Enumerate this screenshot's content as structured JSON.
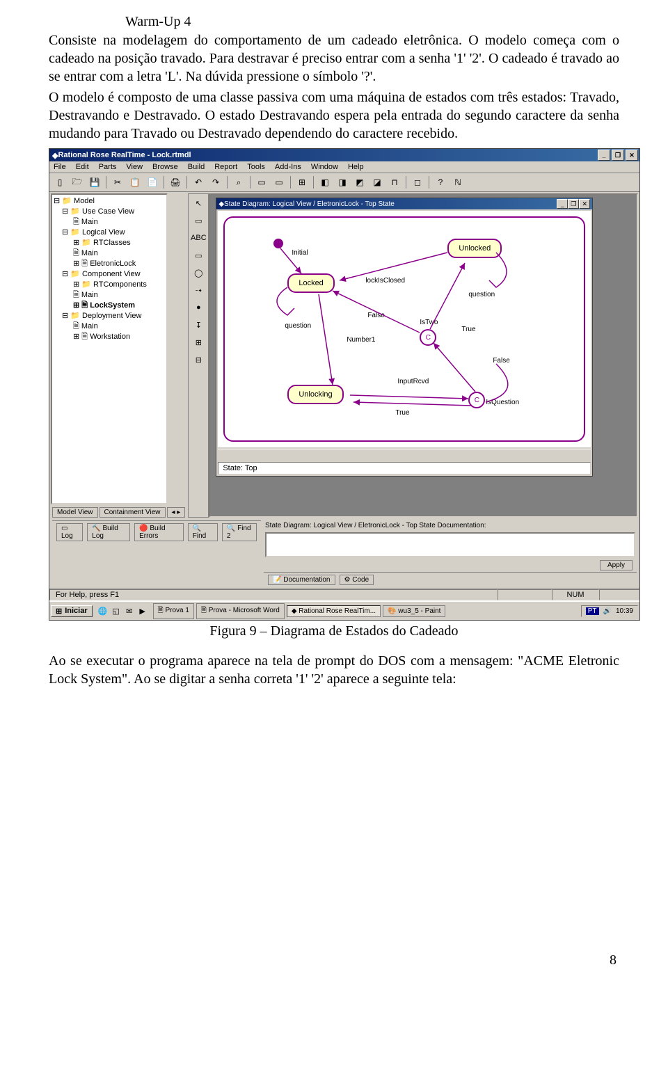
{
  "doc": {
    "title": "Warm-Up 4",
    "p1": "Consiste na modelagem do comportamento de um cadeado eletrônica. O modelo começa com o cadeado na posição travado. Para destravar é preciso entrar com a senha '1' '2'. O cadeado é travado ao se entrar com a letra 'L'. Na dúvida pressione o símbolo '?'.",
    "p2": "O modelo é composto de uma classe passiva com uma máquina de estados com três estados: Travado, Destravando e Destravado. O estado Destravando espera pela entrada do segundo caractere da senha mudando para Travado ou Destravado dependendo do caractere recebido.",
    "fig_caption": "Figura 9 – Diagrama de Estados do Cadeado",
    "p3": "Ao se executar o programa aparece na tela de prompt do DOS com a mensagem: \"ACME Eletronic Lock System\". Ao se digitar a senha correta '1' '2' aparece a seguinte tela:",
    "page_number": "8"
  },
  "app": {
    "window_title": "Rational Rose RealTime - Lock.rtmdl",
    "menus": [
      "File",
      "Edit",
      "Parts",
      "View",
      "Browse",
      "Build",
      "Report",
      "Tools",
      "Add-Ins",
      "Window",
      "Help"
    ],
    "toolbar_icons": [
      "▯",
      "🗁",
      "💾",
      "",
      "✂",
      "📋",
      "📄",
      "",
      "🖨",
      "",
      "↶",
      "↷",
      "",
      "⌕",
      "",
      "▭",
      "▭",
      "",
      "⊞",
      "",
      "◧",
      "◨",
      "◩",
      "◪",
      "⊓",
      "",
      "◻",
      "",
      "?",
      "ℕ"
    ],
    "palette": [
      "↖",
      "▭",
      "ABC",
      "▭",
      "◯",
      "⇢",
      "●",
      "↧",
      "⊞",
      "⊟"
    ],
    "tree": [
      {
        "l": 0,
        "t": "Model"
      },
      {
        "l": 1,
        "t": "Use Case View"
      },
      {
        "l": 2,
        "t": "Main"
      },
      {
        "l": 1,
        "t": "Logical View"
      },
      {
        "l": 2,
        "t": "RTClasses"
      },
      {
        "l": 2,
        "t": "Main"
      },
      {
        "l": 2,
        "t": "EletronicLock"
      },
      {
        "l": 1,
        "t": "Component View"
      },
      {
        "l": 2,
        "t": "RTComponents"
      },
      {
        "l": 2,
        "t": "Main"
      },
      {
        "l": 2,
        "t": "LockSystem"
      },
      {
        "l": 1,
        "t": "Deployment View"
      },
      {
        "l": 2,
        "t": "Main"
      },
      {
        "l": 2,
        "t": "Workstation"
      }
    ],
    "tree_tabs": [
      "Model View",
      "Containment View"
    ],
    "child_title": "State Diagram: Logical View / EletronicLock - Top State",
    "states": {
      "locked": "Locked",
      "unlocked": "Unlocked",
      "unlocking": "Unlocking"
    },
    "labels": {
      "initial": "Initial",
      "lockIsClosed": "lockIsClosed",
      "question_l": "question",
      "question_r": "question",
      "false1": "False",
      "number1": "Number1",
      "istwo": "IsTwo",
      "true1": "True",
      "false2": "False",
      "inputrcvd": "InputRcvd",
      "isquestion": "IsQuestion",
      "true2": "True"
    },
    "state_status": "State: Top",
    "doc_label": "State Diagram: Logical View / EletronicLock - Top State Documentation:",
    "apply": "Apply",
    "doc_tabs": [
      "Documentation",
      "Code"
    ],
    "log_tabs": [
      "Log",
      "Build Log",
      "Build Errors",
      "Find",
      "Find 2"
    ],
    "status_help": "For Help, press F1",
    "status_num": "NUM"
  },
  "taskbar": {
    "start": "Iniciar",
    "buttons": [
      "Prova 1",
      "Prova - Microsoft Word",
      "Rational Rose RealTim...",
      "wu3_5 - Paint"
    ],
    "tray_lang": "PT",
    "tray_time": "10:39"
  }
}
